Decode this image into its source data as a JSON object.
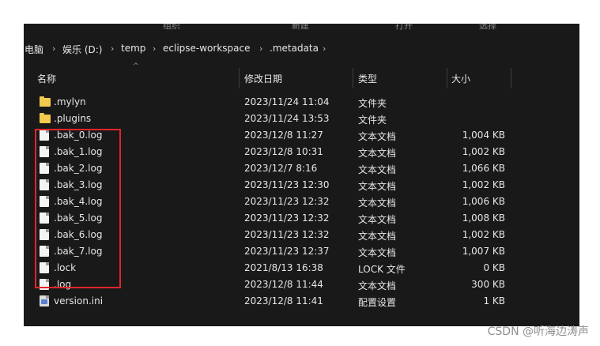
{
  "ribbon": [
    "组织",
    "新建",
    "打开",
    "选择"
  ],
  "breadcrumb": [
    "电脑",
    "娱乐 (D:)",
    "temp",
    "eclipse-workspace",
    ".metadata"
  ],
  "breadcrumb_separator": "›",
  "columns": {
    "name": "名称",
    "date": "修改日期",
    "type": "类型",
    "size": "大小"
  },
  "sort_indicator": "^",
  "files": [
    {
      "icon": "folder-icon",
      "name": ".mylyn",
      "date": "2023/11/24 11:04",
      "type": "文件夹",
      "size": ""
    },
    {
      "icon": "folder-icon",
      "name": ".plugins",
      "date": "2023/11/24 13:53",
      "type": "文件夹",
      "size": ""
    },
    {
      "icon": "text-file-icon",
      "name": ".bak_0.log",
      "date": "2023/12/8 11:27",
      "type": "文本文档",
      "size": "1,004 KB"
    },
    {
      "icon": "text-file-icon",
      "name": ".bak_1.log",
      "date": "2023/12/8 10:31",
      "type": "文本文档",
      "size": "1,002 KB"
    },
    {
      "icon": "text-file-icon",
      "name": ".bak_2.log",
      "date": "2023/12/7 8:16",
      "type": "文本文档",
      "size": "1,066 KB"
    },
    {
      "icon": "text-file-icon",
      "name": ".bak_3.log",
      "date": "2023/11/23 12:30",
      "type": "文本文档",
      "size": "1,002 KB"
    },
    {
      "icon": "text-file-icon",
      "name": ".bak_4.log",
      "date": "2023/11/23 12:32",
      "type": "文本文档",
      "size": "1,006 KB"
    },
    {
      "icon": "text-file-icon",
      "name": ".bak_5.log",
      "date": "2023/11/23 12:32",
      "type": "文本文档",
      "size": "1,008 KB"
    },
    {
      "icon": "text-file-icon",
      "name": ".bak_6.log",
      "date": "2023/11/23 12:32",
      "type": "文本文档",
      "size": "1,002 KB"
    },
    {
      "icon": "text-file-icon",
      "name": ".bak_7.log",
      "date": "2023/11/23 12:37",
      "type": "文本文档",
      "size": "1,007 KB"
    },
    {
      "icon": "blank-file-icon",
      "name": ".lock",
      "date": "2021/8/13 16:38",
      "type": "LOCK 文件",
      "size": "0 KB"
    },
    {
      "icon": "text-file-icon",
      "name": ".log",
      "date": "2023/12/8 11:44",
      "type": "文本文档",
      "size": "300 KB"
    },
    {
      "icon": "settings-file-icon",
      "name": "version.ini",
      "date": "2023/12/8 11:41",
      "type": "配置设置",
      "size": "1 KB"
    }
  ],
  "watermark": "CSDN @听海边涛声",
  "colors": {
    "window_background": "#191919",
    "folder": "#f3c94e",
    "highlight_box": "#e0252b"
  }
}
